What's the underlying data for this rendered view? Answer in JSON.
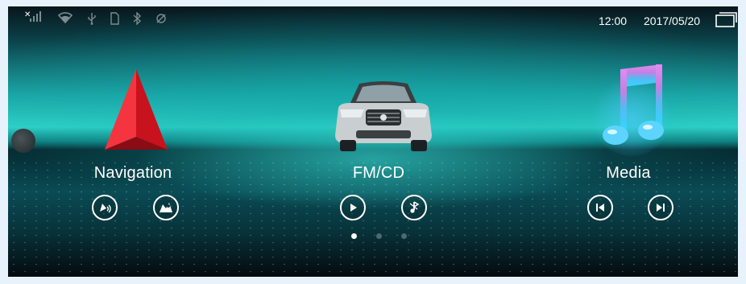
{
  "status_bar": {
    "icons": [
      "signal-off-icon",
      "wifi-icon",
      "usb-icon",
      "sd-card-icon",
      "bluetooth-icon",
      "gps-icon"
    ],
    "time": "12:00",
    "date": "2017/05/20",
    "recents_icon": "recent-apps-icon"
  },
  "apps": [
    {
      "label": "Navigation",
      "icon": "navigation-arrow-icon",
      "controls": [
        "voice-navigation-icon",
        "map-location-icon"
      ]
    },
    {
      "label": "FM/CD",
      "icon": "car-icon",
      "controls": [
        "play-icon",
        "bluetooth-music-icon"
      ]
    },
    {
      "label": "Media",
      "icon": "music-note-icon",
      "controls": [
        "previous-track-icon",
        "next-track-icon"
      ]
    }
  ],
  "pager": {
    "pages": 3,
    "current": 1
  },
  "colors": {
    "background_glow": "#2fd2c8",
    "navigation_accent": "#e8222c",
    "media_accent": "#b04fc0",
    "page_background": "#e7f2fc"
  }
}
